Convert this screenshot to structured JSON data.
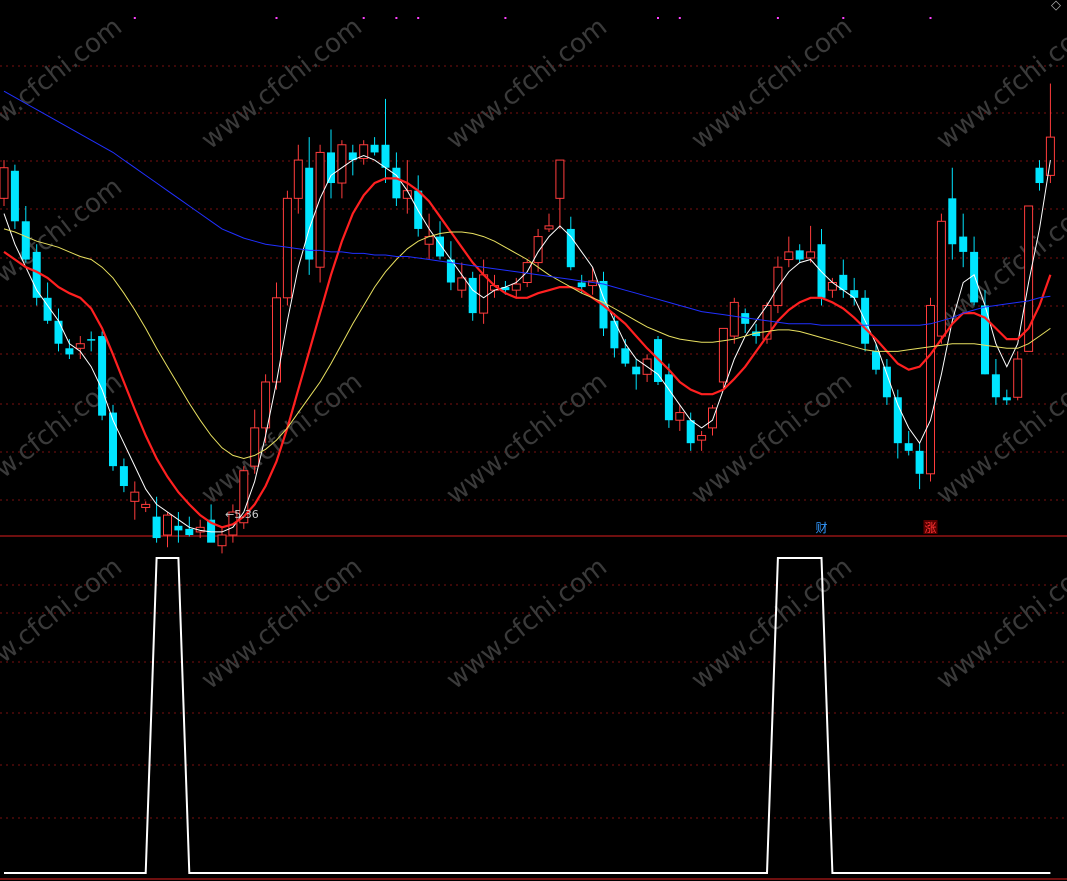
{
  "chart_data": [
    {
      "type": "candlestick",
      "panel": "price",
      "ylim": [
        5.0,
        8.3
      ],
      "grid": true,
      "low_marker_label": "←5.36",
      "event_markers": [
        {
          "index": 75,
          "label": "财",
          "color": "#3399ff"
        },
        {
          "index": 85,
          "label": "涨",
          "color": "#ff3333"
        }
      ],
      "top_tick_markers": [
        12,
        25,
        33,
        36,
        38,
        46,
        60,
        62,
        71,
        77,
        85
      ],
      "ohlc": [
        [
          7.2,
          7.45,
          7.15,
          7.4
        ],
        [
          7.38,
          7.42,
          7.0,
          7.05
        ],
        [
          7.05,
          7.15,
          6.78,
          6.8
        ],
        [
          6.85,
          6.9,
          6.5,
          6.55
        ],
        [
          6.55,
          6.65,
          6.38,
          6.4
        ],
        [
          6.4,
          6.48,
          6.2,
          6.25
        ],
        [
          6.22,
          6.28,
          6.15,
          6.18
        ],
        [
          6.22,
          6.3,
          6.15,
          6.25
        ],
        [
          6.28,
          6.33,
          6.2,
          6.27
        ],
        [
          6.3,
          6.33,
          5.75,
          5.78
        ],
        [
          5.8,
          5.85,
          5.42,
          5.45
        ],
        [
          5.45,
          5.5,
          5.28,
          5.32
        ],
        [
          5.22,
          5.35,
          5.1,
          5.28
        ],
        [
          5.18,
          5.22,
          5.15,
          5.2
        ],
        [
          5.12,
          5.25,
          4.95,
          4.98
        ],
        [
          5.0,
          5.15,
          4.92,
          5.13
        ],
        [
          5.06,
          5.15,
          4.95,
          5.03
        ],
        [
          5.04,
          5.12,
          4.99,
          5.0
        ],
        [
          5.02,
          5.1,
          4.98,
          5.05
        ],
        [
          5.1,
          5.2,
          5.0,
          4.95
        ],
        [
          4.93,
          5.05,
          4.88,
          5.0
        ],
        [
          5.0,
          5.2,
          4.95,
          5.15
        ],
        [
          5.08,
          5.45,
          5.04,
          5.42
        ],
        [
          5.45,
          5.82,
          5.4,
          5.7
        ],
        [
          5.7,
          6.05,
          5.6,
          6.0
        ],
        [
          6.0,
          6.65,
          5.95,
          6.55
        ],
        [
          6.55,
          7.25,
          6.5,
          7.2
        ],
        [
          7.2,
          7.55,
          7.1,
          7.45
        ],
        [
          7.4,
          7.6,
          6.7,
          6.8
        ],
        [
          6.75,
          7.55,
          6.65,
          7.5
        ],
        [
          7.5,
          7.65,
          7.2,
          7.3
        ],
        [
          7.3,
          7.58,
          7.2,
          7.55
        ],
        [
          7.5,
          7.55,
          7.35,
          7.45
        ],
        [
          7.46,
          7.58,
          7.42,
          7.55
        ],
        [
          7.55,
          7.6,
          7.48,
          7.5
        ],
        [
          7.55,
          7.85,
          7.3,
          7.4
        ],
        [
          7.4,
          7.5,
          7.15,
          7.2
        ],
        [
          7.2,
          7.45,
          7.1,
          7.25
        ],
        [
          7.25,
          7.35,
          6.95,
          7.0
        ],
        [
          6.9,
          7.1,
          6.8,
          6.95
        ],
        [
          6.95,
          7.05,
          6.8,
          6.82
        ],
        [
          6.8,
          6.92,
          6.6,
          6.65
        ],
        [
          6.6,
          6.78,
          6.55,
          6.68
        ],
        [
          6.68,
          6.72,
          6.4,
          6.45
        ],
        [
          6.45,
          6.8,
          6.38,
          6.7
        ],
        [
          6.6,
          6.7,
          6.55,
          6.63
        ],
        [
          6.62,
          6.66,
          6.57,
          6.6
        ],
        [
          6.6,
          6.68,
          6.55,
          6.64
        ],
        [
          6.65,
          6.8,
          6.62,
          6.78
        ],
        [
          6.78,
          7.0,
          6.72,
          6.95
        ],
        [
          7.0,
          7.1,
          6.98,
          7.02
        ],
        [
          7.2,
          7.45,
          7.0,
          7.45
        ],
        [
          7.0,
          7.08,
          6.73,
          6.75
        ],
        [
          6.65,
          6.7,
          6.58,
          6.62
        ],
        [
          6.63,
          6.75,
          6.57,
          6.66
        ],
        [
          6.66,
          6.72,
          6.3,
          6.35
        ],
        [
          6.4,
          6.45,
          6.16,
          6.22
        ],
        [
          6.22,
          6.28,
          6.1,
          6.12
        ],
        [
          6.1,
          6.15,
          5.95,
          6.05
        ],
        [
          6.05,
          6.18,
          6.0,
          6.15
        ],
        [
          6.28,
          6.3,
          5.98,
          6.0
        ],
        [
          6.05,
          6.12,
          5.7,
          5.75
        ],
        [
          5.75,
          5.85,
          5.68,
          5.8
        ],
        [
          5.75,
          5.8,
          5.55,
          5.6
        ],
        [
          5.62,
          5.68,
          5.55,
          5.65
        ],
        [
          5.7,
          5.85,
          5.65,
          5.83
        ],
        [
          6.0,
          6.35,
          5.95,
          6.35
        ],
        [
          6.3,
          6.55,
          6.25,
          6.52
        ],
        [
          6.45,
          6.48,
          6.32,
          6.38
        ],
        [
          6.33,
          6.38,
          6.25,
          6.3
        ],
        [
          6.28,
          6.52,
          6.25,
          6.5
        ],
        [
          6.5,
          6.82,
          6.45,
          6.75
        ],
        [
          6.8,
          6.95,
          6.75,
          6.85
        ],
        [
          6.86,
          6.9,
          6.78,
          6.8
        ],
        [
          6.81,
          7.02,
          6.78,
          6.85
        ],
        [
          6.9,
          7.0,
          6.5,
          6.55
        ],
        [
          6.6,
          6.68,
          6.55,
          6.65
        ],
        [
          6.7,
          6.8,
          6.55,
          6.6
        ],
        [
          6.6,
          6.68,
          6.5,
          6.55
        ],
        [
          6.55,
          6.6,
          6.2,
          6.25
        ],
        [
          6.2,
          6.25,
          6.05,
          6.08
        ],
        [
          6.1,
          6.15,
          5.85,
          5.9
        ],
        [
          5.9,
          5.95,
          5.5,
          5.6
        ],
        [
          5.6,
          5.68,
          5.52,
          5.55
        ],
        [
          5.55,
          5.6,
          5.3,
          5.4
        ],
        [
          5.4,
          6.55,
          5.35,
          6.5
        ],
        [
          6.3,
          7.1,
          6.25,
          7.05
        ],
        [
          7.2,
          7.4,
          6.8,
          6.9
        ],
        [
          6.95,
          7.1,
          6.75,
          6.85
        ],
        [
          6.85,
          6.95,
          6.5,
          6.52
        ],
        [
          6.5,
          6.6,
          6.05,
          6.05
        ],
        [
          6.05,
          6.15,
          5.85,
          5.9
        ],
        [
          5.9,
          5.95,
          5.85,
          5.88
        ],
        [
          5.9,
          6.2,
          5.88,
          6.15
        ],
        [
          6.2,
          7.15,
          6.2,
          7.15
        ],
        [
          7.4,
          7.45,
          7.25,
          7.3
        ],
        [
          7.35,
          7.95,
          7.3,
          7.6
        ]
      ],
      "series": [
        {
          "color": "#ffffff",
          "values": [
            7.1,
            6.9,
            6.75,
            6.6,
            6.5,
            6.4,
            6.25,
            6.2,
            6.1,
            5.95,
            5.75,
            5.6,
            5.45,
            5.3,
            5.2,
            5.15,
            5.1,
            5.05,
            5.03,
            5.02,
            5.02,
            5.05,
            5.15,
            5.35,
            5.65,
            6.0,
            6.4,
            6.75,
            7.0,
            7.2,
            7.35,
            7.4,
            7.45,
            7.48,
            7.45,
            7.4,
            7.35,
            7.25,
            7.12,
            7.0,
            6.9,
            6.8,
            6.7,
            6.6,
            6.55,
            6.6,
            6.62,
            6.65,
            6.72,
            6.85,
            6.95,
            7.02,
            6.95,
            6.85,
            6.75,
            6.55,
            6.4,
            6.25,
            6.15,
            6.1,
            6.05,
            5.95,
            5.85,
            5.75,
            5.7,
            5.75,
            5.95,
            6.15,
            6.3,
            6.4,
            6.5,
            6.62,
            6.72,
            6.78,
            6.8,
            6.72,
            6.65,
            6.6,
            6.55,
            6.4,
            6.25,
            6.05,
            5.85,
            5.7,
            5.6,
            5.75,
            6.05,
            6.4,
            6.65,
            6.7,
            6.5,
            6.25,
            6.1,
            6.25,
            6.65,
            7.0,
            7.45
          ]
        },
        {
          "color": "#ff2020",
          "values": [
            6.85,
            6.8,
            6.75,
            6.72,
            6.68,
            6.62,
            6.58,
            6.55,
            6.48,
            6.35,
            6.18,
            6.0,
            5.82,
            5.65,
            5.5,
            5.38,
            5.28,
            5.2,
            5.13,
            5.08,
            5.05,
            5.07,
            5.12,
            5.2,
            5.32,
            5.48,
            5.7,
            5.95,
            6.2,
            6.45,
            6.7,
            6.92,
            7.1,
            7.22,
            7.3,
            7.33,
            7.33,
            7.3,
            7.25,
            7.18,
            7.08,
            6.98,
            6.88,
            6.78,
            6.7,
            6.63,
            6.58,
            6.55,
            6.55,
            6.58,
            6.6,
            6.62,
            6.62,
            6.6,
            6.55,
            6.5,
            6.44,
            6.38,
            6.3,
            6.22,
            6.15,
            6.08,
            6.0,
            5.95,
            5.92,
            5.92,
            5.95,
            6.02,
            6.1,
            6.2,
            6.3,
            6.4,
            6.47,
            6.52,
            6.55,
            6.55,
            6.52,
            6.48,
            6.42,
            6.35,
            6.28,
            6.2,
            6.12,
            6.08,
            6.1,
            6.18,
            6.28,
            6.38,
            6.45,
            6.45,
            6.42,
            6.35,
            6.28,
            6.28,
            6.35,
            6.5,
            6.7
          ]
        },
        {
          "color": "#e8e060",
          "values": [
            7.0,
            6.98,
            6.95,
            6.92,
            6.9,
            6.88,
            6.85,
            6.82,
            6.8,
            6.75,
            6.68,
            6.58,
            6.47,
            6.35,
            6.22,
            6.1,
            5.98,
            5.86,
            5.75,
            5.65,
            5.57,
            5.52,
            5.5,
            5.52,
            5.56,
            5.62,
            5.7,
            5.8,
            5.9,
            6.0,
            6.12,
            6.25,
            6.38,
            6.5,
            6.62,
            6.72,
            6.8,
            6.87,
            6.92,
            6.95,
            6.97,
            6.98,
            6.98,
            6.97,
            6.95,
            6.92,
            6.88,
            6.84,
            6.8,
            6.75,
            6.7,
            6.66,
            6.62,
            6.58,
            6.55,
            6.52,
            6.48,
            6.44,
            6.4,
            6.36,
            6.33,
            6.3,
            6.28,
            6.27,
            6.26,
            6.26,
            6.27,
            6.28,
            6.3,
            6.32,
            6.33,
            6.34,
            6.34,
            6.33,
            6.31,
            6.29,
            6.27,
            6.25,
            6.23,
            6.21,
            6.2,
            6.2,
            6.2,
            6.21,
            6.22,
            6.23,
            6.24,
            6.25,
            6.25,
            6.25,
            6.24,
            6.23,
            6.22,
            6.22,
            6.25,
            6.3,
            6.35
          ]
        },
        {
          "color": "#2030ff",
          "values": [
            7.9,
            7.86,
            7.82,
            7.78,
            7.74,
            7.7,
            7.66,
            7.62,
            7.58,
            7.54,
            7.5,
            7.45,
            7.4,
            7.35,
            7.3,
            7.25,
            7.2,
            7.15,
            7.1,
            7.05,
            7.0,
            6.97,
            6.94,
            6.92,
            6.9,
            6.89,
            6.88,
            6.87,
            6.86,
            6.86,
            6.85,
            6.85,
            6.84,
            6.84,
            6.83,
            6.83,
            6.82,
            6.82,
            6.81,
            6.8,
            6.79,
            6.78,
            6.77,
            6.76,
            6.75,
            6.74,
            6.73,
            6.72,
            6.71,
            6.7,
            6.69,
            6.68,
            6.67,
            6.66,
            6.65,
            6.64,
            6.62,
            6.6,
            6.58,
            6.56,
            6.54,
            6.52,
            6.5,
            6.48,
            6.46,
            6.45,
            6.44,
            6.43,
            6.42,
            6.41,
            6.4,
            6.39,
            6.38,
            6.38,
            6.38,
            6.37,
            6.37,
            6.37,
            6.37,
            6.37,
            6.37,
            6.37,
            6.37,
            6.37,
            6.37,
            6.38,
            6.4,
            6.42,
            6.45,
            6.47,
            6.49,
            6.5,
            6.51,
            6.52,
            6.53,
            6.55,
            6.56
          ]
        }
      ]
    },
    {
      "type": "line",
      "panel": "indicator",
      "ylim": [
        0,
        1
      ],
      "grid": true,
      "series": [
        {
          "color": "#ffffff",
          "values": [
            0,
            0,
            0,
            0,
            0,
            0,
            0,
            0,
            0,
            0,
            0,
            0,
            0,
            0,
            1,
            1,
            1,
            0,
            0,
            0,
            0,
            0,
            0,
            0,
            0,
            0,
            0,
            0,
            0,
            0,
            0,
            0,
            0,
            0,
            0,
            0,
            0,
            0,
            0,
            0,
            0,
            0,
            0,
            0,
            0,
            0,
            0,
            0,
            0,
            0,
            0,
            0,
            0,
            0,
            0,
            0,
            0,
            0,
            0,
            0,
            0,
            0,
            0,
            0,
            0,
            0,
            0,
            0,
            0,
            0,
            0,
            1,
            1,
            1,
            1,
            1,
            0,
            0,
            0,
            0,
            0,
            0,
            0,
            0,
            0,
            0,
            0,
            0,
            0,
            0,
            0,
            0,
            0,
            0,
            0,
            0,
            0
          ]
        }
      ]
    }
  ],
  "watermark_text": "www.cfchi.com",
  "corner_icon": "diamond-outline-icon"
}
